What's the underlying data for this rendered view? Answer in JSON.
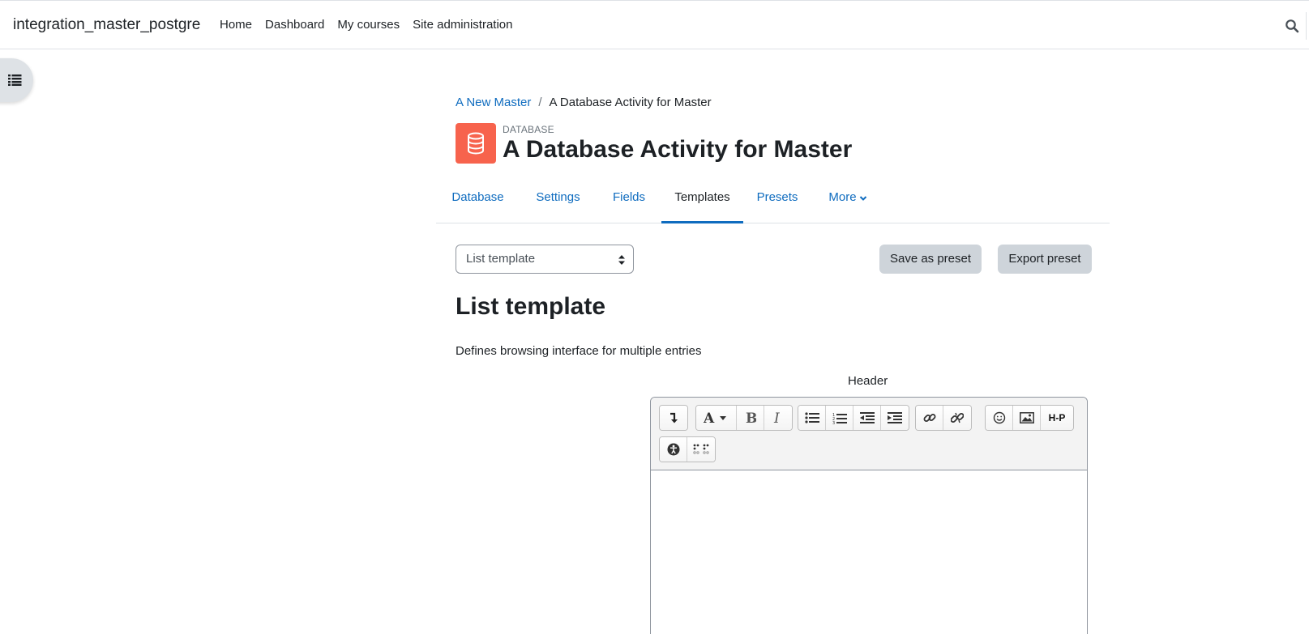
{
  "site": {
    "name": "integration_master_postgre"
  },
  "primary_nav": [
    "Home",
    "Dashboard",
    "My courses",
    "Site administration"
  ],
  "breadcrumb": {
    "course": "A New Master",
    "separator": "/",
    "activity": "A Database Activity for Master"
  },
  "activity": {
    "type_label": "DATABASE",
    "title": "A Database Activity for Master",
    "icon": "database-icon",
    "icon_color": "#f7634d"
  },
  "tabs": [
    "Database",
    "Settings",
    "Fields",
    "Templates",
    "Presets",
    "More"
  ],
  "active_tab": "Templates",
  "template_select": {
    "selected": "List template"
  },
  "buttons": {
    "save_preset": "Save as preset",
    "export_preset": "Export preset"
  },
  "section": {
    "heading": "List template",
    "description": "Defines browsing interface for multiple entries"
  },
  "editor": {
    "field_label": "Header",
    "toolbar_icons": [
      "toolbar-toggle-icon",
      "font-style-icon",
      "bold-icon",
      "italic-icon",
      "unordered-list-icon",
      "ordered-list-icon",
      "outdent-icon",
      "indent-icon",
      "link-icon",
      "unlink-icon",
      "emoji-icon",
      "image-icon",
      "h5p-icon",
      "accessibility-checker-icon",
      "screen-reader-helper-icon"
    ],
    "h5p_label": "H-P",
    "content": ""
  },
  "colors": {
    "link": "#0f6cbf",
    "text": "#1d2125",
    "secondary_button": "#ced4da"
  }
}
